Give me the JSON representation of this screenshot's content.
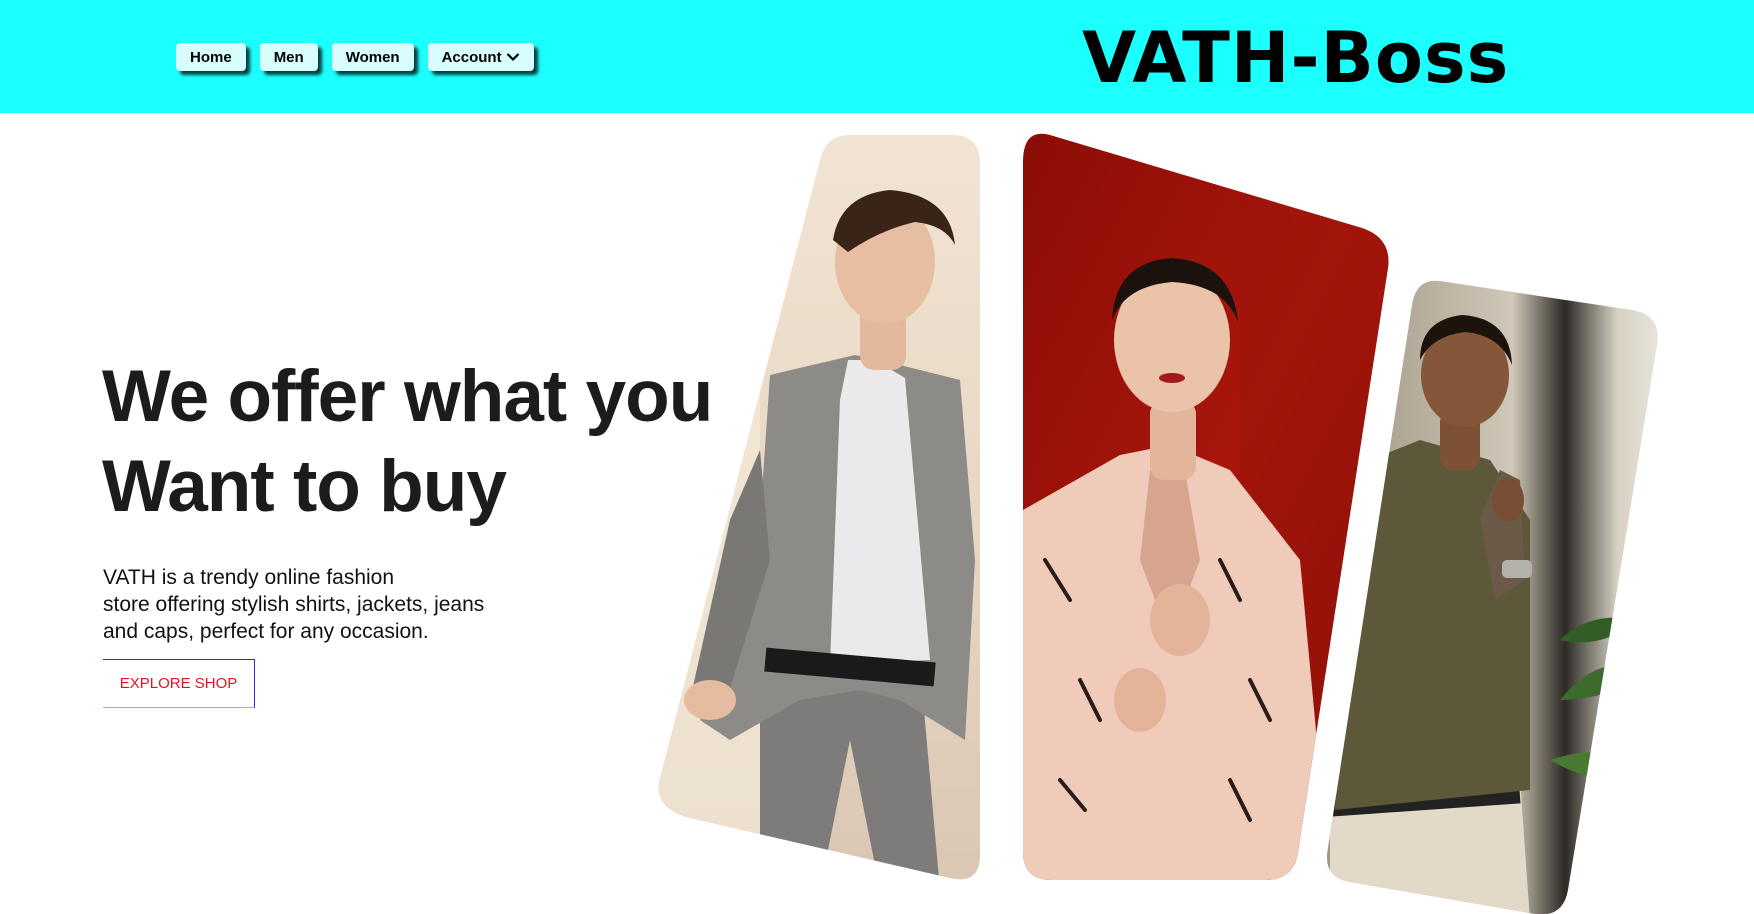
{
  "nav": {
    "items": [
      {
        "label": "Home"
      },
      {
        "label": "Men"
      },
      {
        "label": "Women"
      },
      {
        "label": "Account"
      }
    ]
  },
  "brand": {
    "name": "VATH-Boss"
  },
  "hero": {
    "title_lines": [
      "We offer what you",
      "Want to buy"
    ],
    "description_lines": [
      "VATH is a trendy online fashion",
      "store offering stylish shirts, jackets, jeans",
      "and caps, perfect for any occasion."
    ],
    "cta_label": "EXPLORE SHOP"
  },
  "colors": {
    "header_bg": "#1cffff",
    "nav_button_bg": "#d8fdfd",
    "cta_text": "#e0141f",
    "title_text": "#1c1c1c"
  },
  "icons": {
    "account_dropdown": "chevron-down-icon"
  },
  "gallery": {
    "images": [
      {
        "subject": "man-grey-suit"
      },
      {
        "subject": "woman-pink-jacket-red-wall"
      },
      {
        "subject": "man-olive-shirt"
      }
    ]
  }
}
